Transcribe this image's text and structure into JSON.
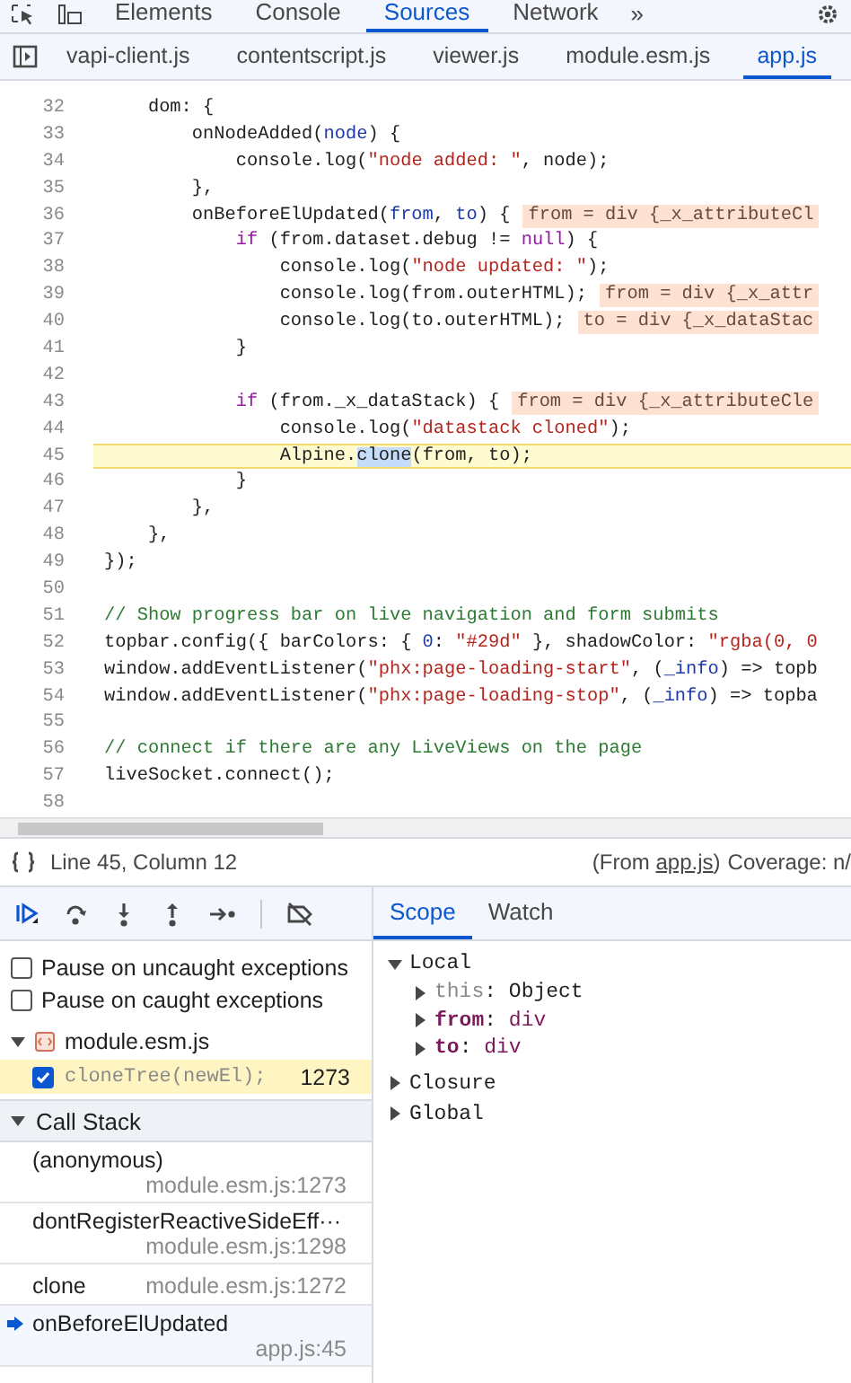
{
  "main_tabs": [
    {
      "label": "Elements",
      "selected": false
    },
    {
      "label": "Console",
      "selected": false
    },
    {
      "label": "Sources",
      "selected": true
    },
    {
      "label": "Network",
      "selected": false
    }
  ],
  "more_tabs": "»",
  "file_tabs": [
    {
      "label": "vapi-client.js",
      "selected": false
    },
    {
      "label": "contentscript.js",
      "selected": false
    },
    {
      "label": "viewer.js",
      "selected": false
    },
    {
      "label": "module.esm.js",
      "selected": false
    },
    {
      "label": "app.js",
      "selected": true
    }
  ],
  "code_lines": [
    {
      "number": "32",
      "paused": false,
      "tokens": [
        {
          "kind": "plain",
          "text": "    dom: {"
        }
      ]
    },
    {
      "number": "33",
      "paused": false,
      "tokens": [
        {
          "kind": "plain",
          "text": "        onNodeAdded("
        },
        {
          "kind": "param",
          "text": "node"
        },
        {
          "kind": "plain",
          "text": ") {"
        }
      ]
    },
    {
      "number": "34",
      "paused": false,
      "tokens": [
        {
          "kind": "plain",
          "text": "            console.log("
        },
        {
          "kind": "string",
          "text": "\"node added: \""
        },
        {
          "kind": "plain",
          "text": ", node);"
        }
      ]
    },
    {
      "number": "35",
      "paused": false,
      "tokens": [
        {
          "kind": "plain",
          "text": "        },"
        }
      ]
    },
    {
      "number": "36",
      "paused": false,
      "tokens": [
        {
          "kind": "plain",
          "text": "        onBeforeElUpdated("
        },
        {
          "kind": "param",
          "text": "from"
        },
        {
          "kind": "plain",
          "text": ", "
        },
        {
          "kind": "param",
          "text": "to"
        },
        {
          "kind": "plain",
          "text": ") {"
        }
      ],
      "inline_value": "from = div {_x_attributeCl"
    },
    {
      "number": "37",
      "paused": false,
      "tokens": [
        {
          "kind": "keyword",
          "text": "            if"
        },
        {
          "kind": "plain",
          "text": " (from.dataset.debug != "
        },
        {
          "kind": "keyword",
          "text": "null"
        },
        {
          "kind": "plain",
          "text": ") {"
        }
      ]
    },
    {
      "number": "38",
      "paused": false,
      "tokens": [
        {
          "kind": "plain",
          "text": "                console.log("
        },
        {
          "kind": "string",
          "text": "\"node updated: \""
        },
        {
          "kind": "plain",
          "text": ");"
        }
      ]
    },
    {
      "number": "39",
      "paused": false,
      "tokens": [
        {
          "kind": "plain",
          "text": "                console.log(from.outerHTML);"
        }
      ],
      "inline_value": "from = div {_x_attr"
    },
    {
      "number": "40",
      "paused": false,
      "tokens": [
        {
          "kind": "plain",
          "text": "                console.log(to.outerHTML);"
        }
      ],
      "inline_value": "to = div {_x_dataStac"
    },
    {
      "number": "41",
      "paused": false,
      "tokens": [
        {
          "kind": "plain",
          "text": "            }"
        }
      ]
    },
    {
      "number": "42",
      "paused": false
    },
    {
      "number": "43",
      "paused": false,
      "tokens": [
        {
          "kind": "keyword",
          "text": "            if"
        },
        {
          "kind": "plain",
          "text": " (from._x_dataStack) {"
        }
      ],
      "inline_value": "from = div {_x_attributeCle"
    },
    {
      "number": "44",
      "paused": false,
      "tokens": [
        {
          "kind": "plain",
          "text": "                console.log("
        },
        {
          "kind": "string",
          "text": "\"datastack cloned\""
        },
        {
          "kind": "plain",
          "text": ");"
        }
      ]
    },
    {
      "number": "45",
      "paused": true,
      "tokens": [
        {
          "kind": "plain",
          "text": "                Alpine."
        },
        {
          "kind": "selection",
          "text": "clone"
        },
        {
          "kind": "plain",
          "text": "(from, to);"
        }
      ]
    },
    {
      "number": "46",
      "paused": false,
      "tokens": [
        {
          "kind": "plain",
          "text": "            }"
        }
      ]
    },
    {
      "number": "47",
      "paused": false,
      "tokens": [
        {
          "kind": "plain",
          "text": "        },"
        }
      ]
    },
    {
      "number": "48",
      "paused": false,
      "tokens": [
        {
          "kind": "plain",
          "text": "    },"
        }
      ]
    },
    {
      "number": "49",
      "paused": false,
      "tokens": [
        {
          "kind": "plain",
          "text": "});"
        }
      ]
    },
    {
      "number": "50",
      "paused": false
    },
    {
      "number": "51",
      "paused": false,
      "tokens": [
        {
          "kind": "comment",
          "text": "// Show progress bar on live navigation and form submits"
        }
      ]
    },
    {
      "number": "52",
      "paused": false,
      "tokens": [
        {
          "kind": "plain",
          "text": "topbar.config({ barColors: { "
        },
        {
          "kind": "number",
          "text": "0"
        },
        {
          "kind": "plain",
          "text": ": "
        },
        {
          "kind": "string",
          "text": "\"#29d\""
        },
        {
          "kind": "plain",
          "text": " }, shadowColor: "
        },
        {
          "kind": "string",
          "text": "\"rgba(0, 0"
        }
      ]
    },
    {
      "number": "53",
      "paused": false,
      "tokens": [
        {
          "kind": "plain",
          "text": "window.addEventListener("
        },
        {
          "kind": "string",
          "text": "\"phx:page-loading-start\""
        },
        {
          "kind": "plain",
          "text": ", ("
        },
        {
          "kind": "param",
          "text": "_info"
        },
        {
          "kind": "plain",
          "text": ") => topb"
        }
      ]
    },
    {
      "number": "54",
      "paused": false,
      "tokens": [
        {
          "kind": "plain",
          "text": "window.addEventListener("
        },
        {
          "kind": "string",
          "text": "\"phx:page-loading-stop\""
        },
        {
          "kind": "plain",
          "text": ", ("
        },
        {
          "kind": "param",
          "text": "_info"
        },
        {
          "kind": "plain",
          "text": ") => topba"
        }
      ]
    },
    {
      "number": "55",
      "paused": false
    },
    {
      "number": "56",
      "paused": false,
      "tokens": [
        {
          "kind": "comment",
          "text": "// connect if there are any LiveViews on the page"
        }
      ]
    },
    {
      "number": "57",
      "paused": false,
      "tokens": [
        {
          "kind": "plain",
          "text": "liveSocket.connect();"
        }
      ]
    },
    {
      "number": "58",
      "paused": false
    }
  ],
  "status_bar": {
    "position": "Line 45, Column 12",
    "source_before": "(From ",
    "source_link": "app.js",
    "source_after": ")",
    "coverage": "Coverage: n/"
  },
  "sidebar_tabs": [
    {
      "label": "Scope",
      "selected": true
    },
    {
      "label": "Watch",
      "selected": false
    }
  ],
  "pause_options": [
    {
      "label": "Pause on uncaught exceptions",
      "checked": false
    },
    {
      "label": "Pause on caught exceptions",
      "checked": false
    }
  ],
  "breakpoint_files": [
    {
      "name": "module.esm.js",
      "expanded": true,
      "breakpoints": [
        {
          "code": "cloneTree(newEl);",
          "line": "1273",
          "checked": true,
          "hit": true
        }
      ]
    }
  ],
  "call_stack": {
    "title": "Call Stack",
    "expanded": true,
    "frames": [
      {
        "function": "(anonymous)",
        "location": "module.esm.js:1273",
        "kind": "stacked",
        "current": false
      },
      {
        "function": "dontRegisterReactiveSideEff···",
        "location": "module.esm.js:1298",
        "kind": "stacked",
        "current": false
      },
      {
        "function": "clone",
        "location": "module.esm.js:1272",
        "kind": "inline",
        "current": false
      },
      {
        "function": "onBeforeElUpdated",
        "location": "app.js:45",
        "kind": "stacked",
        "current": true
      }
    ]
  },
  "scope": [
    {
      "name": "Local",
      "expanded": true,
      "children": [
        {
          "name": "this",
          "separator": ":",
          "value": "Object",
          "kind": "receiver",
          "expanded": false
        },
        {
          "name": "from",
          "separator": ":",
          "value": "div",
          "kind": "argument",
          "expanded": false
        },
        {
          "name": "to",
          "separator": ":",
          "value": "div",
          "kind": "argument",
          "expanded": false
        }
      ]
    },
    {
      "name": "Closure",
      "expanded": false
    },
    {
      "name": "Global",
      "expanded": false
    }
  ]
}
